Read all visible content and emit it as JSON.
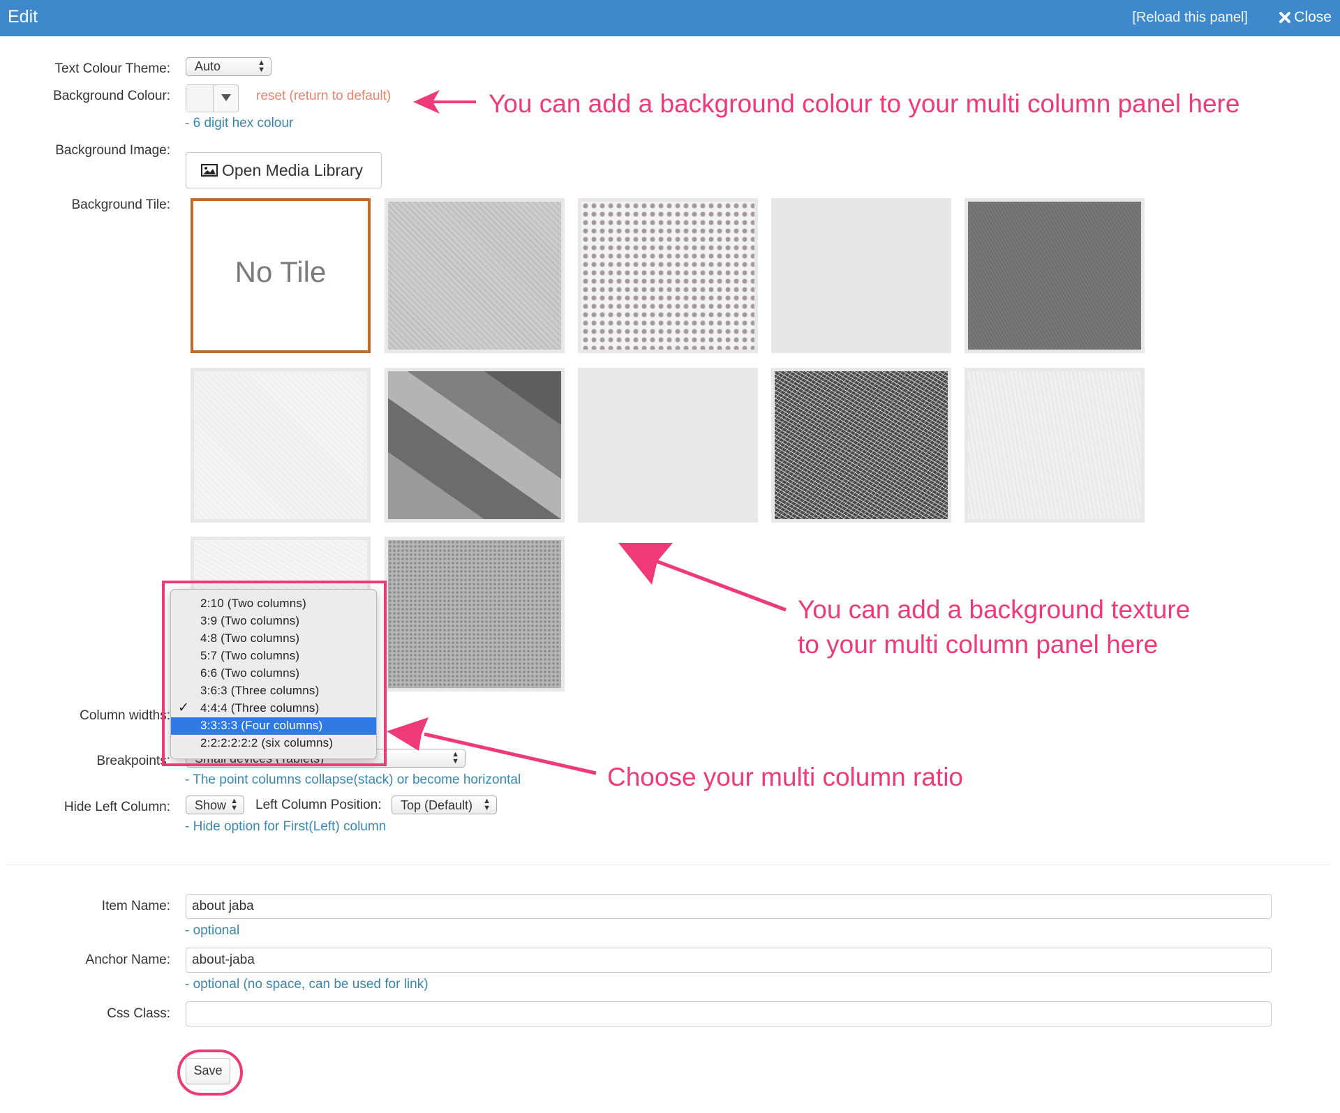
{
  "header": {
    "title": "Edit",
    "reload_label": "[Reload this panel]",
    "close_label": "Close"
  },
  "form": {
    "text_colour_theme": {
      "label": "Text Colour Theme:",
      "value": "Auto"
    },
    "background_colour": {
      "label": "Background Colour:",
      "reset_label": "reset (return to default)",
      "help": "- 6 digit hex colour"
    },
    "background_image": {
      "label": "Background Image:",
      "button_label": "Open Media Library"
    },
    "background_tile": {
      "label": "Background Tile:",
      "no_tile_label": "No Tile"
    },
    "column_widths": {
      "label": "Column widths:",
      "options": [
        "2:10 (Two columns)",
        "3:9 (Two columns)",
        "4:8 (Two columns)",
        "5:7 (Two columns)",
        "6:6 (Two columns)",
        "3:6:3 (Three columns)",
        "4:4:4 (Three columns)",
        "3:3:3:3 (Four columns)",
        "2:2:2:2:2:2 (six columns)"
      ],
      "checked_option": "4:4:4 (Three columns)",
      "highlighted_option": "3:3:3:3 (Four columns)"
    },
    "breakpoints": {
      "label": "Breakpoints:",
      "value": "Small devices (Tablets)",
      "help": "- The point columns collapse(stack) or become horizontal"
    },
    "hide_left_column": {
      "label": "Hide Left Column:",
      "value": "Show",
      "position_label": "Left Column Position:",
      "position_value": "Top (Default)",
      "help": "- Hide option for First(Left) column"
    },
    "item_name": {
      "label": "Item Name:",
      "value": "about jaba",
      "help": "- optional"
    },
    "anchor_name": {
      "label": "Anchor Name:",
      "value": "about-jaba",
      "help": "- optional (no space, can be used for link)"
    },
    "css_class": {
      "label": "Css Class:",
      "value": ""
    },
    "save_label": "Save"
  },
  "annotations": {
    "background_colour": "You can add a background colour to your multi column panel here",
    "texture_line1": "You can add a background texture",
    "texture_line2": "to your multi column panel here",
    "column_ratio": "Choose your multi column ratio"
  },
  "colors": {
    "header_bg": "#3f88cc",
    "annotation": "#ee3a78",
    "help_text": "#3a87ad",
    "selected_tile_border": "#c66a26",
    "highlight_option": "#2f7ae5"
  }
}
